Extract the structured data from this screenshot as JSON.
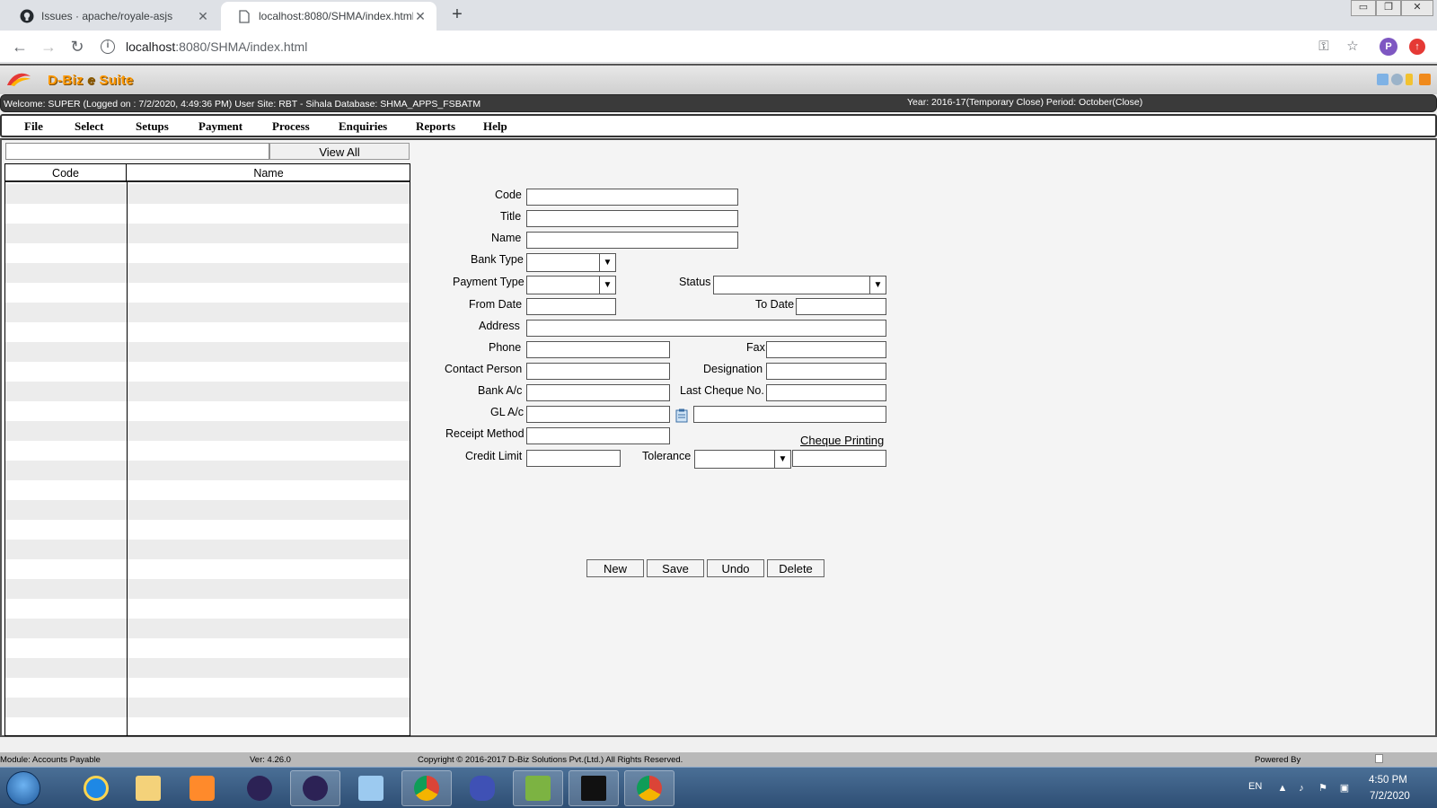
{
  "browser": {
    "tabs": [
      {
        "title": "Issues · apache/royale-asjs",
        "icon": "github-icon"
      },
      {
        "title": "localhost:8080/SHMA/index.html",
        "icon": "page-icon"
      }
    ],
    "url_host": "localhost",
    "url_rest": ":8080/SHMA/index.html",
    "profile_initial": "P"
  },
  "app": {
    "name_left": "D-Biz",
    "name_mid": "e",
    "name_right": "Suite",
    "welcome": "Welcome: SUPER (Logged on : 7/2/2020, 4:49:36 PM) User Site: RBT - Sihala Database: SHMA_APPS_FSBATM",
    "period": "Year: 2016-17(Temporary Close) Period: October(Close)"
  },
  "menu": [
    "File",
    "Select",
    "Setups",
    "Payment",
    "Process",
    "Enquiries",
    "Reports",
    "Help"
  ],
  "list": {
    "search_value": "",
    "view_all_label": "View All",
    "columns": [
      "Code",
      "Name"
    ],
    "rows": []
  },
  "form": {
    "labels": {
      "code": "Code",
      "title": "Title",
      "name": "Name",
      "bank_type": "Bank Type",
      "payment_type": "Payment Type",
      "status": "Status",
      "from_date": "From Date",
      "to_date": "To Date",
      "address": "Address",
      "phone": "Phone",
      "fax": "Fax",
      "contact_person": "Contact Person",
      "designation": "Designation",
      "bank_ac": "Bank A/c",
      "last_cheque_no": "Last Cheque No.",
      "gl_ac": "GL A/c",
      "receipt_method": "Receipt Method",
      "cheque_printing": "Cheque Printing",
      "credit_limit": "Credit Limit",
      "tolerance": "Tolerance"
    },
    "buttons": {
      "new": "New",
      "save": "Save",
      "undo": "Undo",
      "delete": "Delete"
    }
  },
  "status_bar": {
    "module": "Module: Accounts Payable",
    "version": "Ver: 4.26.0",
    "copyright": "Copyright © 2016-2017 D-Biz Solutions Pvt.(Ltd.) All Rights Reserved.",
    "powered_by": "Powered By"
  },
  "taskbar": {
    "lang": "EN",
    "time": "4:50 PM",
    "date": "7/2/2020"
  }
}
